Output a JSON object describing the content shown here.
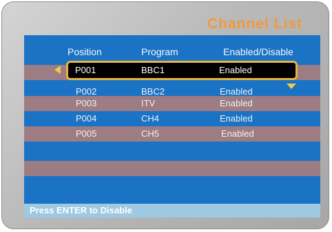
{
  "title": "Channel List",
  "headers": {
    "position": "Position",
    "program": "Program",
    "enabled": "Enabled/Disable"
  },
  "rows": [
    {
      "position": "P001",
      "program": "BBC1",
      "status": "Enabled",
      "selected": true
    },
    {
      "position": "P002",
      "program": "BBC2",
      "status": "Enabled"
    },
    {
      "position": "P003",
      "program": "ITV",
      "status": "Enabled"
    },
    {
      "position": "P004",
      "program": "CH4",
      "status": "Enabled"
    },
    {
      "position": "P005",
      "program": "CH5",
      "status": "Enabled"
    }
  ],
  "status_bar": "Press ENTER to Disable",
  "icons": {
    "left": "left-arrow-icon",
    "down": "down-arrow-icon"
  },
  "colors": {
    "title": "#ef9a3c",
    "panel": "#1a73c4",
    "band": "#9d7c84",
    "selection_border": "#e9b341",
    "status_bar": "#9ec9e3"
  }
}
